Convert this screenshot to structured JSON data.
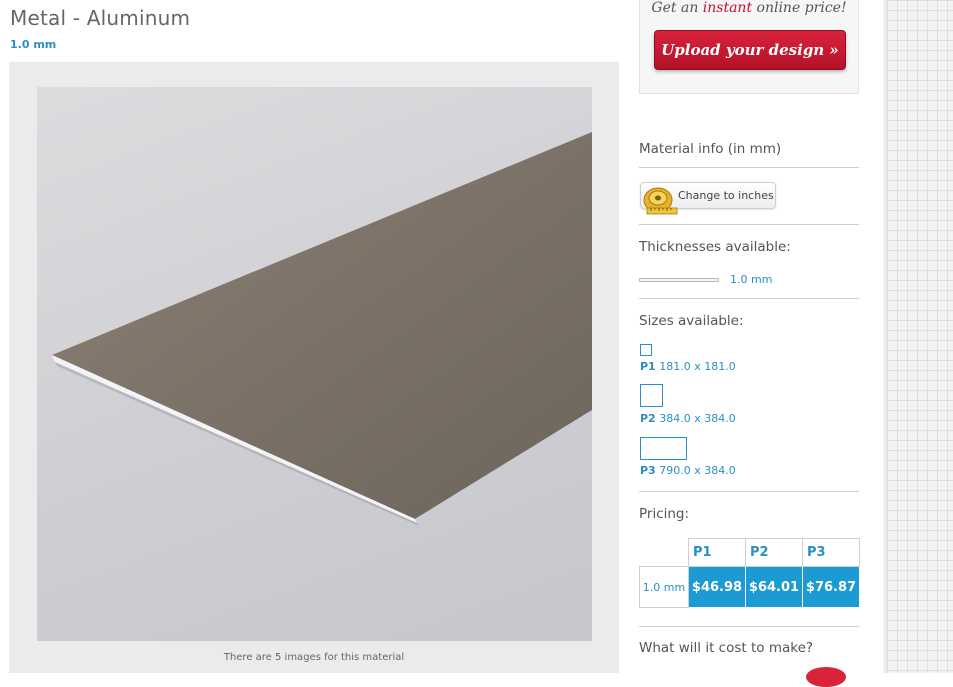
{
  "product": {
    "title": "Metal - Aluminum",
    "thickness_label": "1.0 mm"
  },
  "gallery": {
    "caption": "There are 5 images for this material"
  },
  "cta": {
    "lead_before": "Get an ",
    "lead_highlight": "instant",
    "lead_after": " online price!",
    "button_label": "Upload your design »",
    "highlight_color": "#c8102e"
  },
  "material_info": {
    "heading": "Material info (in mm)",
    "units_button_label": "Change to inches"
  },
  "thicknesses": {
    "heading": "Thicknesses available:",
    "items": [
      "1.0 mm"
    ]
  },
  "sizes": {
    "heading": "Sizes available:",
    "items": [
      {
        "code": "P1",
        "dims": "181.0 x 181.0"
      },
      {
        "code": "P2",
        "dims": "384.0 x 384.0"
      },
      {
        "code": "P3",
        "dims": "790.0 x 384.0"
      }
    ]
  },
  "pricing": {
    "heading": "Pricing:",
    "columns": [
      "P1",
      "P2",
      "P3"
    ],
    "rows": [
      {
        "thickness": "1.0 mm",
        "prices": [
          "$46.98",
          "$64.01",
          "$76.87"
        ]
      }
    ],
    "accent_color": "#1c9ad3"
  },
  "cost": {
    "heading": "What will it cost to make?"
  }
}
